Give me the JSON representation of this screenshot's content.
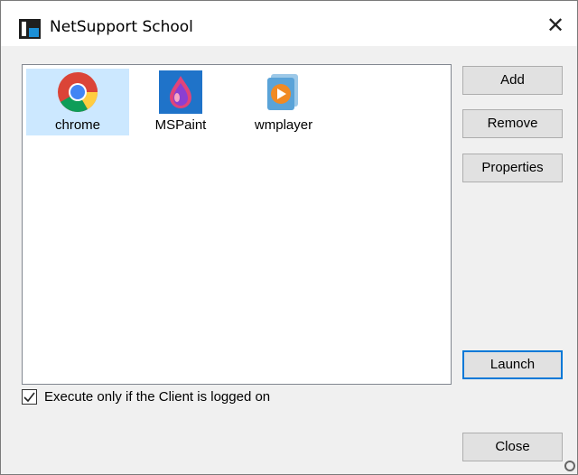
{
  "window": {
    "title": "NetSupport School"
  },
  "apps": [
    {
      "label": "chrome",
      "icon": "chrome-icon",
      "selected": true
    },
    {
      "label": "MSPaint",
      "icon": "mspaint-icon",
      "selected": false
    },
    {
      "label": "wmplayer",
      "icon": "wmplayer-icon",
      "selected": false
    }
  ],
  "buttons": {
    "add": "Add",
    "remove": "Remove",
    "properties": "Properties",
    "launch": "Launch",
    "close": "Close"
  },
  "option": {
    "label": "Execute only if the Client is logged on",
    "checked": true
  },
  "colors": {
    "selection": "#cce8ff",
    "accent": "#0078d7"
  }
}
